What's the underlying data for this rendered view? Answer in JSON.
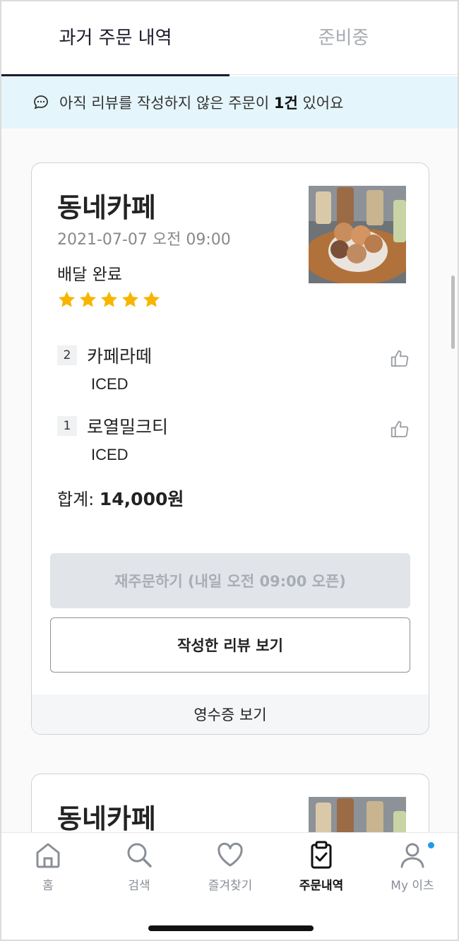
{
  "tabs": [
    {
      "label": "과거 주문 내역",
      "active": true
    },
    {
      "label": "준비중",
      "active": false
    }
  ],
  "banner": {
    "prefix": "아직 리뷰를 작성하지 않은 주문이 ",
    "count": "1건",
    "suffix": " 있어요",
    "icon": "chat-bubble-icon"
  },
  "orders": [
    {
      "store": "동네카페",
      "datetime": "2021-07-07 오전 09:00",
      "status": "배달 완료",
      "rating": 5,
      "items": [
        {
          "qty": "2",
          "name": "카페라떼",
          "option": "ICED"
        },
        {
          "qty": "1",
          "name": "로열밀크티",
          "option": "ICED"
        }
      ],
      "total_label": "합계:",
      "total_value": "14,000원",
      "reorder_label": "재주문하기 (내일 오전 09:00 오픈)",
      "review_label": "작성한 리뷰 보기",
      "receipt_label": "영수증 보기"
    },
    {
      "store": "동네카페"
    }
  ],
  "bottom_nav": [
    {
      "label": "홈",
      "icon": "home-icon"
    },
    {
      "label": "검색",
      "icon": "search-icon"
    },
    {
      "label": "즐겨찾기",
      "icon": "heart-icon"
    },
    {
      "label": "주문내역",
      "icon": "clipboard-check-icon",
      "active": true
    },
    {
      "label": "My 이츠",
      "icon": "user-icon"
    }
  ],
  "colors": {
    "accent": "#1e1a33",
    "banner_bg": "#e5f5fc",
    "star": "#f7b500",
    "notification_dot": "#1e9be8"
  }
}
